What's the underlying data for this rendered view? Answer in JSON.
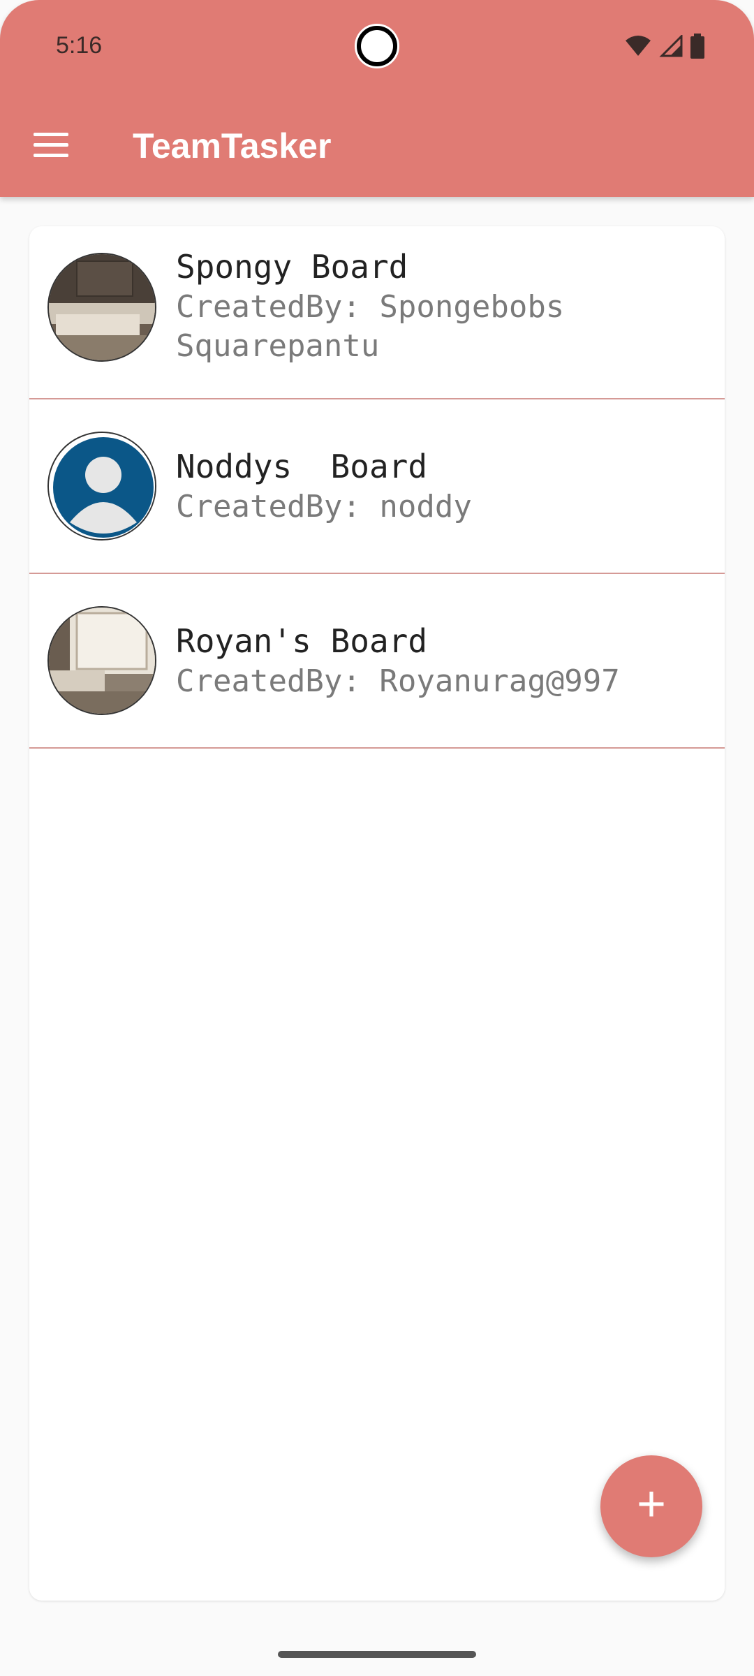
{
  "status_bar": {
    "time": "5:16",
    "icons": [
      "wifi-icon",
      "signal-icon",
      "battery-icon"
    ]
  },
  "app_bar": {
    "menu_icon": "hamburger-menu-icon",
    "title": "TeamTasker"
  },
  "boards": [
    {
      "title": "Spongy Board",
      "subtitle": "CreatedBy: Spongebobs Squarepantu",
      "avatar": "living-room-photo"
    },
    {
      "title": "Noddys  Board",
      "subtitle": "CreatedBy: noddy",
      "avatar": "default-user-avatar"
    },
    {
      "title": "Royan's Board",
      "subtitle": "CreatedBy: Royanurag@997",
      "avatar": "living-room-photo"
    }
  ],
  "fab": {
    "label": "+",
    "icon": "add-icon"
  },
  "colors": {
    "accent": "#e07b74",
    "divider": "#d59a96",
    "avatar_blue": "#0b5788"
  }
}
